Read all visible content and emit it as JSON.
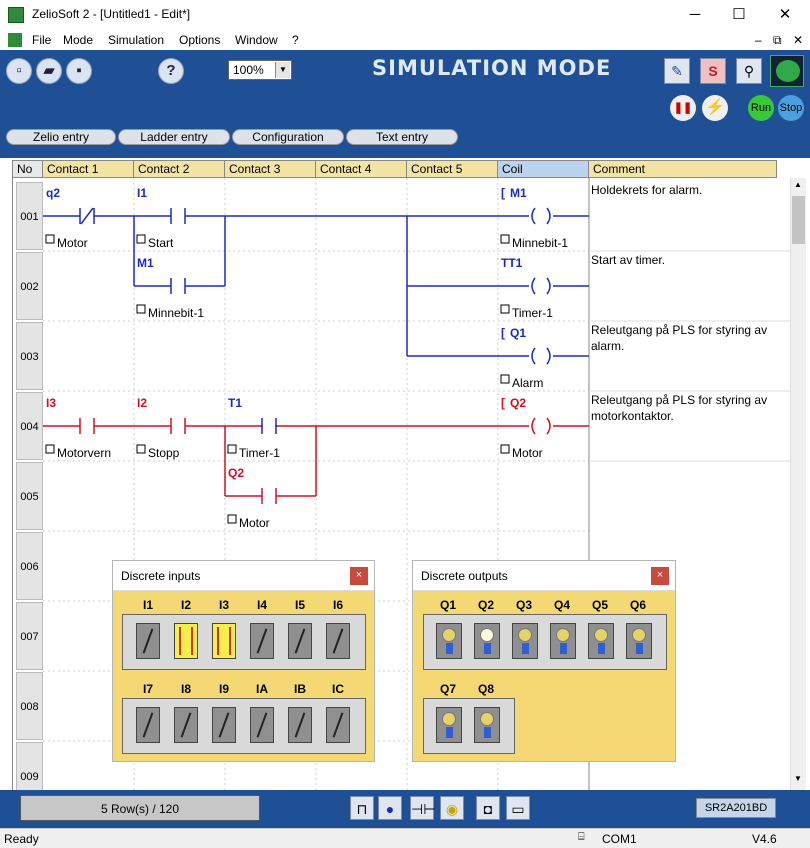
{
  "window": {
    "title": "ZelioSoft 2 - [Untitled1 - Edit*]",
    "min": "─",
    "max": "☐",
    "close": "✕"
  },
  "menu": {
    "items": [
      "File",
      "Mode",
      "Simulation",
      "Options",
      "Window",
      "?"
    ],
    "mdi": [
      "–",
      "⧉",
      "✕"
    ]
  },
  "toolbar": {
    "zoom": "100%",
    "mode_title": "SIMULATION MODE",
    "s_label": "S",
    "run": "Run",
    "stop": "Stop",
    "help": "?"
  },
  "tabs": [
    "Zelio entry",
    "Ladder entry",
    "Configuration",
    "Text entry"
  ],
  "grid": {
    "headers": [
      "No",
      "Contact 1",
      "Contact 2",
      "Contact 3",
      "Contact 4",
      "Contact 5",
      "Coil",
      "Comment"
    ],
    "rows": [
      "001",
      "002",
      "003",
      "004",
      "005",
      "006",
      "007",
      "008",
      "009"
    ],
    "comments": {
      "r1": "Holdekrets for alarm.",
      "r2": "Start av timer.",
      "r3": "Releutgang på PLS for styring av alarm.",
      "r4": "Releutgang på PLS for styring av motorkontaktor."
    },
    "elements": {
      "q2": "q2",
      "motor1": "Motor",
      "i1": "I1",
      "start": "Start",
      "m1c": "M1",
      "minnebit1": "Minnebit-1",
      "coil1": "M1",
      "coil1lbl": "Minnebit-1",
      "coil2": "TT1",
      "coil2lbl": "Timer-1",
      "coil3": "Q1",
      "coil3lbl": "Alarm",
      "i3": "I3",
      "motorvern": "Motorvern",
      "i2": "I2",
      "stopp": "Stopp",
      "t1": "T1",
      "timer1": "Timer-1",
      "coil4": "Q2",
      "coil4lbl": "Motor",
      "q2b": "Q2",
      "motor2": "Motor",
      "coilbracket": "["
    }
  },
  "status": {
    "rows": "5 Row(s) / 120",
    "model": "SR2A201BD",
    "ready": "Ready",
    "port": "COM1",
    "version": "V4.6"
  },
  "inputs_panel": {
    "title": "Discrete inputs",
    "close": "×",
    "row1": [
      "I1",
      "I2",
      "I3",
      "I4",
      "I5",
      "I6"
    ],
    "row2": [
      "I7",
      "I8",
      "I9",
      "IA",
      "IB",
      "IC"
    ],
    "states_row1": [
      false,
      true,
      true,
      false,
      false,
      false
    ],
    "states_row2": [
      false,
      false,
      false,
      false,
      false,
      false
    ]
  },
  "outputs_panel": {
    "title": "Discrete outputs",
    "close": "×",
    "row1": [
      "Q1",
      "Q2",
      "Q3",
      "Q4",
      "Q5",
      "Q6"
    ],
    "row2": [
      "Q7",
      "Q8"
    ],
    "states_row1": [
      false,
      true,
      false,
      false,
      false,
      false
    ],
    "states_row2": [
      false,
      false
    ]
  },
  "colors": {
    "toolbar_bg": "#1f4f95",
    "active_line": "#d01020",
    "inactive_line": "#1a2bbd",
    "panel_bg": "#f4d874",
    "header_bg": "#f3e4a4"
  }
}
